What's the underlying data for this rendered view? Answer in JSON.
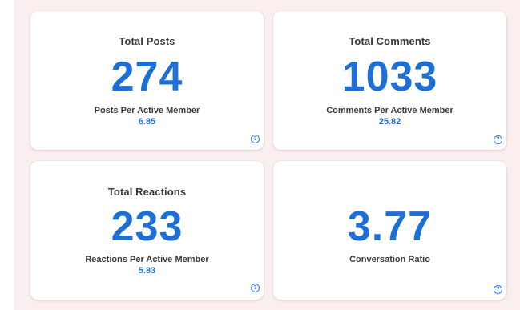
{
  "cards": [
    {
      "title": "Total Posts",
      "value": "274",
      "sub_label": "Posts Per Active Member",
      "sub_value": "6.85",
      "help_icon": "question-circle-icon"
    },
    {
      "title": "Total Comments",
      "value": "1033",
      "sub_label": "Comments Per Active Member",
      "sub_value": "25.82",
      "help_icon": "question-circle-icon"
    },
    {
      "title": "Total Reactions",
      "value": "233",
      "sub_label": "Reactions Per Active Member",
      "sub_value": "5.83",
      "help_icon": "question-circle-icon"
    },
    {
      "title": "",
      "value": "3.77",
      "sub_label": "Conversation Ratio",
      "sub_value": "",
      "help_icon": "question-circle-icon"
    }
  ],
  "colors": {
    "accent": "#1d6fd6",
    "panel_background": "#fbeeee",
    "card_background": "#ffffff",
    "label_text": "#3a3a3a"
  }
}
